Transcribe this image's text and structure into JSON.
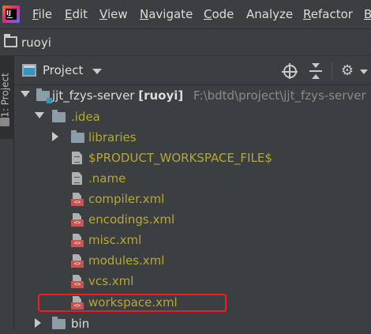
{
  "menubar": {
    "items": [
      {
        "label": "File",
        "mnemonic": "F"
      },
      {
        "label": "Edit",
        "mnemonic": "E"
      },
      {
        "label": "View",
        "mnemonic": "V"
      },
      {
        "label": "Navigate",
        "mnemonic": "N"
      },
      {
        "label": "Code",
        "mnemonic": "C"
      },
      {
        "label": "Analyze",
        "mnemonic": ""
      },
      {
        "label": "Refactor",
        "mnemonic": "R"
      },
      {
        "label": "B",
        "mnemonic": "B"
      }
    ]
  },
  "navbar": {
    "label": "ruoyi",
    "icon": "folder-icon"
  },
  "side_strip": {
    "tab_label": "1: Project"
  },
  "project_panel": {
    "title": "Project",
    "icons": [
      "project-icon",
      "locate-target-icon",
      "collapse-all-icon",
      "gear-icon",
      "chevron-down-icon"
    ]
  },
  "tree": {
    "root": {
      "name": "jjt_fzys-server",
      "module": "[ruoyi]",
      "path": "F:\\bdtd\\project\\jjt_fzys-server"
    },
    "idea_folder": ".idea",
    "items": [
      {
        "label": "libraries",
        "type": "folder"
      },
      {
        "label": "$PRODUCT_WORKSPACE_FILE$",
        "type": "file"
      },
      {
        "label": ".name",
        "type": "file"
      },
      {
        "label": "compiler.xml",
        "type": "xml"
      },
      {
        "label": "encodings.xml",
        "type": "xml"
      },
      {
        "label": "misc.xml",
        "type": "xml"
      },
      {
        "label": "modules.xml",
        "type": "xml"
      },
      {
        "label": "vcs.xml",
        "type": "xml"
      },
      {
        "label": "workspace.xml",
        "type": "xml"
      }
    ],
    "bin_folder": "bin"
  },
  "colors": {
    "background": "#3c3f41",
    "text": "#dcdcdc",
    "file_text": "#b7a832",
    "highlight": "#ff1a1a",
    "xml_badge": "#c75450"
  }
}
